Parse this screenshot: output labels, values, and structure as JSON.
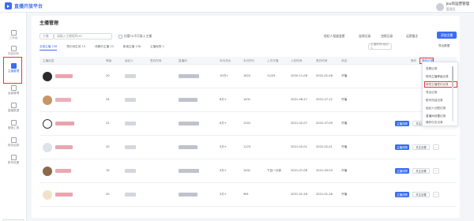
{
  "app": {
    "name": "直播开放平台"
  },
  "user": {
    "name": "Jou的运营管理",
    "role": "管理员"
  },
  "sidebar": {
    "items": [
      {
        "label": "工作台"
      },
      {
        "label": "内容创作"
      },
      {
        "label": "主播管理"
      },
      {
        "label": "运营管理"
      },
      {
        "label": "直播数据"
      },
      {
        "label": "营销工具"
      },
      {
        "label": "财务结算"
      },
      {
        "label": "账号设置"
      }
    ],
    "lang": "简体"
  },
  "page": {
    "title": "主播管理"
  },
  "filters": {
    "type_select": "主播",
    "search_placeholder": "请输入主播昵称/ID",
    "only_self_label": "仅看TA不可接入主播"
  },
  "toolbar": {
    "links": [
      "经纪人批量变更",
      "连线记录",
      "违规记录",
      "运营备注"
    ],
    "add_button": "添加主播",
    "export_label": "导出数据"
  },
  "tabs": [
    {
      "label": "全部主播 238",
      "active": true
    },
    {
      "label": "签约待生效 13"
    },
    {
      "label": "待解约主播 23"
    },
    {
      "label": "新增主播 158"
    },
    {
      "label": "主播标签 1"
    }
  ],
  "column_search_placeholder": "主播昵称/经纪人",
  "table": {
    "headers": [
      "主播信息",
      "等级",
      "经纪人",
      "签约时间",
      "直播间",
      "本月流水",
      "本月时长",
      "上次开播",
      "入驻时间",
      "签约时间",
      "状态",
      "操作"
    ],
    "rows": [
      {
        "level": "20",
        "amount": "10万+",
        "val2": "1622",
        "val3": "11/29",
        "date1": "2020-11-08",
        "date2": "2022-01-08",
        "status": "开播",
        "btn": "主播详情",
        "menu": "关注设置"
      },
      {
        "level": "24",
        "amount": "8万+",
        "val2": "1431",
        "val3": "",
        "date1": "2021-06-27",
        "date2": "2022-07-12",
        "status": "开播",
        "btn": "主播详情",
        "menu": "关注设置"
      },
      {
        "level": "22",
        "amount": "6万+",
        "val2": "1201",
        "val3": "",
        "date1": "2021-02-07",
        "date2": "2022-07-09",
        "status": "开播",
        "btn": "主播详情",
        "menu": "关注设置"
      },
      {
        "level": "20",
        "amount": "5万+",
        "val2": "1123",
        "val3": "",
        "date1": "2021-02-01",
        "date2": "2022-02-01",
        "status": "开播",
        "btn": "主播详情",
        "menu": "关注设置"
      },
      {
        "level": "19",
        "amount": "4万+",
        "val2": "1041",
        "val3": "下迈一分钟",
        "date1": "2021-07-08",
        "date2": "2021-09-03",
        "status": "开播",
        "btn": "主播详情",
        "menu": "关注设置"
      },
      {
        "level": "20",
        "amount": "3万+",
        "val2": "961",
        "val3": "",
        "date1": "2021-01-28",
        "date2": "2021-01-28",
        "status": "开播",
        "btn": "主播详情",
        "menu": "关注设置"
      }
    ]
  },
  "dropdown": {
    "header": "操作记录",
    "items": [
      "查看记录",
      "修改主播等级记录",
      "修改主播签约记录",
      "导出记录",
      "账号冻结记录",
      "经纪人分配记录",
      "直播间设置记录",
      "操作日志记录"
    ]
  },
  "colors": {
    "accent": "#3b6cf6",
    "highlight": "#e53935"
  }
}
